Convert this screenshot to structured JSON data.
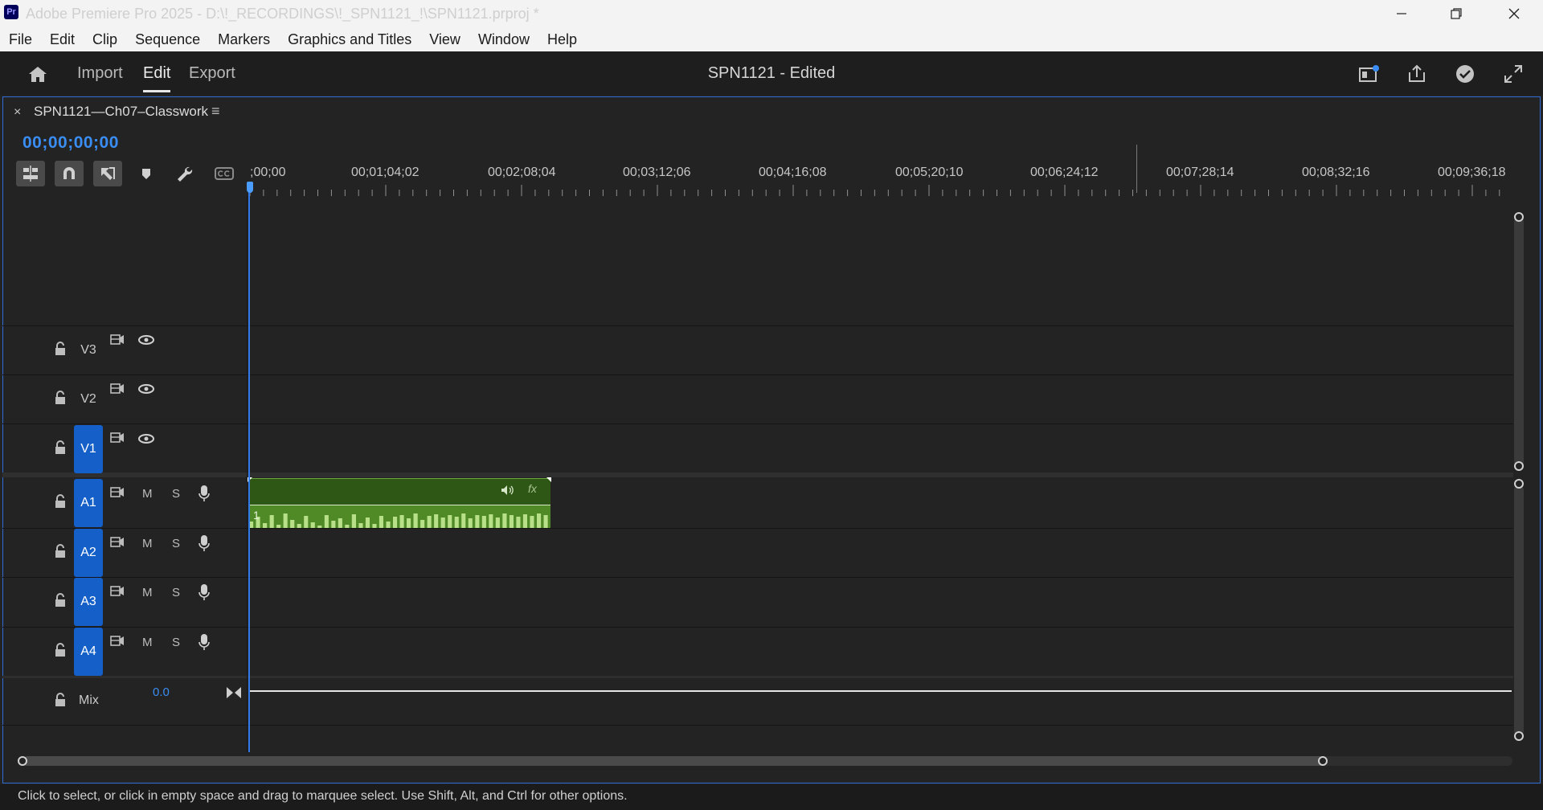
{
  "window": {
    "app_badge": "Pr",
    "title": "Adobe Premiere Pro 2025 - D:\\!_RECORDINGS\\!_SPN1121_!\\SPN1121.prproj *"
  },
  "menu": [
    "File",
    "Edit",
    "Clip",
    "Sequence",
    "Markers",
    "Graphics and Titles",
    "View",
    "Window",
    "Help"
  ],
  "header": {
    "tabs": [
      "Import",
      "Edit",
      "Export"
    ],
    "active_tab": "Edit",
    "project_title": "SPN1121 - Edited"
  },
  "sequence": {
    "tab_name": "SPN1121—Ch07–Classwork",
    "close": "×",
    "menu": "≡",
    "timecode": "00;00;00;00"
  },
  "ruler": {
    "labels": [
      ";00;00",
      "00;01;04;02",
      "00;02;08;04",
      "00;03;12;06",
      "00;04;16;08",
      "00;05;20;10",
      "00;06;24;12",
      "00;07;28;14",
      "00;08;32;16",
      "00;09;36;18"
    ]
  },
  "tracks": {
    "video": [
      {
        "name": "V3",
        "targeted": false
      },
      {
        "name": "V2",
        "targeted": false
      },
      {
        "name": "V1",
        "targeted": true
      }
    ],
    "audio": [
      {
        "name": "A1",
        "mute": "M",
        "solo": "S"
      },
      {
        "name": "A2",
        "mute": "M",
        "solo": "S"
      },
      {
        "name": "A3",
        "mute": "M",
        "solo": "S"
      },
      {
        "name": "A4",
        "mute": "M",
        "solo": "S"
      }
    ],
    "mix": {
      "name": "Mix",
      "value": "0.0"
    }
  },
  "clip": {
    "index": "1",
    "fx": "fx"
  },
  "status": "Click to select, or click in empty space and drag to marquee select. Use Shift, Alt, and Ctrl for other options.",
  "colors": {
    "accent": "#2f7ae8",
    "clip": "#3a6a1e",
    "track_target": "#1560c8"
  }
}
